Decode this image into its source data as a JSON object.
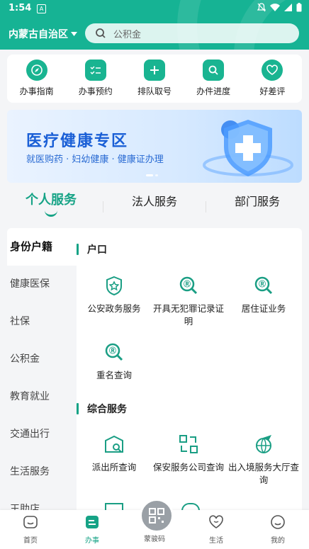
{
  "status": {
    "time": "1:54",
    "a_badge": "A"
  },
  "header": {
    "region": "内蒙古自治区",
    "search_placeholder": "公积金"
  },
  "quick_actions": [
    {
      "label": "办事指南",
      "icon": "compass-icon"
    },
    {
      "label": "办事预约",
      "icon": "checklist-icon"
    },
    {
      "label": "排队取号",
      "icon": "plus-icon"
    },
    {
      "label": "办件进度",
      "icon": "search-icon"
    },
    {
      "label": "好差评",
      "icon": "heart-icon"
    }
  ],
  "banner": {
    "title": "医疗健康专区",
    "subtitle": "就医购药 · 妇幼健康 · 健康证办理"
  },
  "tabs": [
    {
      "label": "个人服务"
    },
    {
      "label": "法人服务"
    },
    {
      "label": "部门服务"
    }
  ],
  "sidebar": [
    {
      "label": "身份户籍"
    },
    {
      "label": "健康医保"
    },
    {
      "label": "社保"
    },
    {
      "label": "公积金"
    },
    {
      "label": "教育就业"
    },
    {
      "label": "交通出行"
    },
    {
      "label": "生活服务"
    },
    {
      "label": "王助店"
    }
  ],
  "sections": [
    {
      "title": "户口",
      "items": [
        {
          "label": "公安政务服务",
          "icon": "police-badge-icon"
        },
        {
          "label": "开具无犯罪记录证明",
          "icon": "search-doc-icon"
        },
        {
          "label": "居住证业务",
          "icon": "search-doc-icon"
        },
        {
          "label": "重名查询",
          "icon": "search-doc-icon"
        }
      ]
    },
    {
      "title": "综合服务",
      "items": [
        {
          "label": "派出所查询",
          "icon": "station-icon"
        },
        {
          "label": "保安服务公司查询",
          "icon": "exchange-icon"
        },
        {
          "label": "出入境服务大厅查询",
          "icon": "plane-globe-icon"
        }
      ]
    }
  ],
  "bottom_nav": [
    {
      "label": "首页",
      "icon": "home-icon"
    },
    {
      "label": "办事",
      "icon": "tasks-icon"
    },
    {
      "label": "蒙骏码",
      "icon": "qr-code-icon"
    },
    {
      "label": "生活",
      "icon": "heart-outline-icon"
    },
    {
      "label": "我的",
      "icon": "user-face-icon"
    }
  ],
  "colors": {
    "accent": "#16b394",
    "accent_dark": "#16a386",
    "banner_text": "#1a5fd6"
  }
}
